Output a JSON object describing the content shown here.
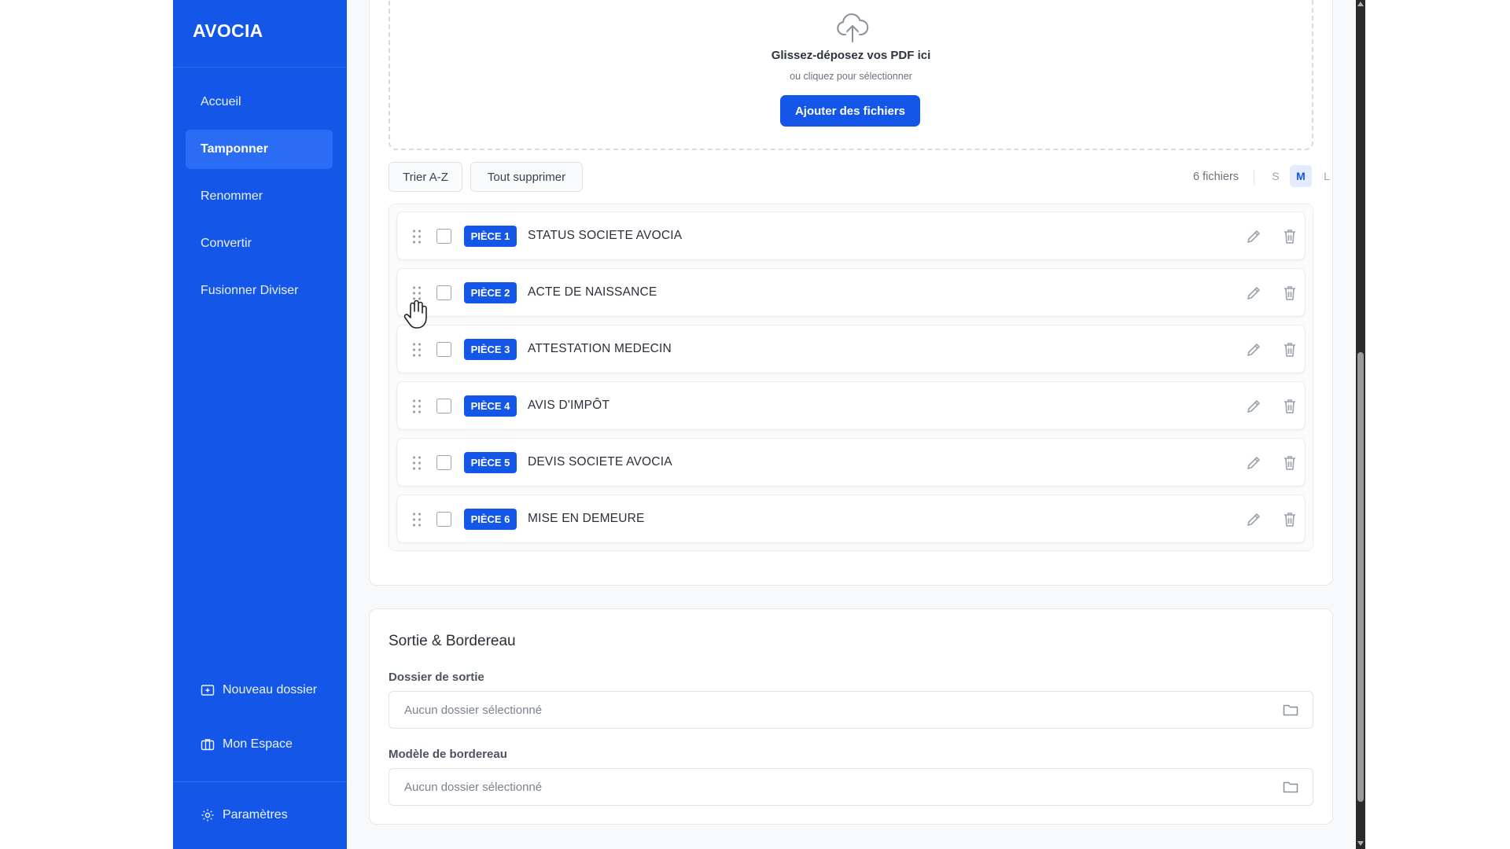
{
  "app": {
    "brand": "AVOCIA"
  },
  "colors": {
    "primary": "#1456e8",
    "sidebar": "#1456e8",
    "active_nav": "#2b6cf5",
    "page_bg": "#f7f8fa"
  },
  "sidebar": {
    "nav": [
      {
        "label": "Accueil",
        "active": false
      },
      {
        "label": "Tamponner",
        "active": true
      },
      {
        "label": "Renommer",
        "active": false
      },
      {
        "label": "Convertir",
        "active": false
      },
      {
        "label": "Fusionner Diviser",
        "active": false
      }
    ],
    "bottom": {
      "new_folder": "Nouveau dossier",
      "my_space": "Mon Espace",
      "settings": "Paramètres"
    }
  },
  "upload": {
    "title": "Glissez-déposez vos PDF ici",
    "subtitle": "ou cliquez pour sélectionner",
    "button": "Ajouter des fichiers",
    "icon": "cloud-upload-icon"
  },
  "toolbar": {
    "sort_label": "Trier A-Z",
    "delete_all_label": "Tout supprimer",
    "files_count": "6 fichiers",
    "sizes": [
      {
        "label": "S",
        "active": false
      },
      {
        "label": "M",
        "active": true
      },
      {
        "label": "L",
        "active": false
      }
    ]
  },
  "files": [
    {
      "badge": "PIÈCE 1",
      "name": "STATUS SOCIETE AVOCIA"
    },
    {
      "badge": "PIÈCE 2",
      "name": "ACTE DE NAISSANCE"
    },
    {
      "badge": "PIÈCE 3",
      "name": "ATTESTATION MEDECIN"
    },
    {
      "badge": "PIÈCE 4",
      "name": "AVIS D'IMPÔT"
    },
    {
      "badge": "PIÈCE 5",
      "name": "DEVIS SOCIETE AVOCIA"
    },
    {
      "badge": "PIÈCE 6",
      "name": "MISE EN DEMEURE"
    }
  ],
  "output": {
    "title": "Sortie & Bordereau",
    "output_folder_label": "Dossier de sortie",
    "output_folder_placeholder": "Aucun dossier sélectionné",
    "template_label": "Modèle de bordereau",
    "template_placeholder": "Aucun dossier sélectionné"
  }
}
